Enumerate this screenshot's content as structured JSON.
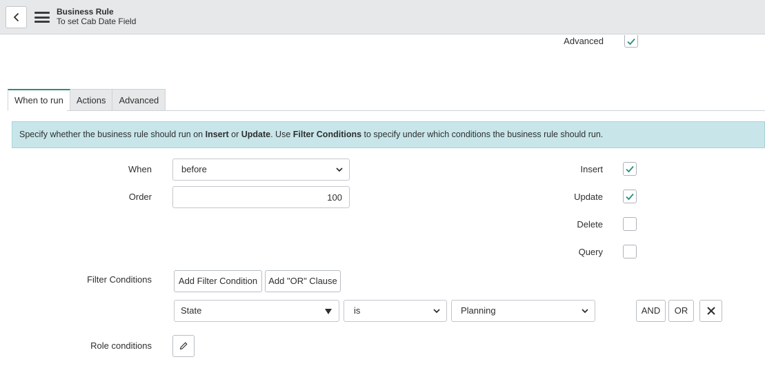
{
  "header": {
    "title": "Business Rule",
    "subtitle": "To set Cab Date Field"
  },
  "top_fields": {
    "advanced_label": "Advanced",
    "advanced_checked": true
  },
  "tabs": [
    {
      "label": "When to run",
      "active": true
    },
    {
      "label": "Actions",
      "active": false
    },
    {
      "label": "Advanced",
      "active": false
    }
  ],
  "info": {
    "part1": "Specify whether the business rule should run on ",
    "insert": "Insert",
    "or": " or ",
    "update": "Update",
    "part2": ". Use ",
    "filter": "Filter Conditions",
    "part3": " to specify under which conditions the business rule should run."
  },
  "form": {
    "when_label": "When",
    "when_value": "before",
    "order_label": "Order",
    "order_value": "100",
    "insert_label": "Insert",
    "insert_checked": true,
    "update_label": "Update",
    "update_checked": true,
    "delete_label": "Delete",
    "delete_checked": false,
    "query_label": "Query",
    "query_checked": false,
    "filter_label": "Filter Conditions",
    "add_filter_btn": "Add Filter Condition",
    "add_or_btn": "Add \"OR\" Clause",
    "condition": {
      "field": "State",
      "operator": "is",
      "value": "Planning"
    },
    "and_btn": "AND",
    "or_btn": "OR",
    "role_label": "Role conditions"
  },
  "colors": {
    "accent": "#278e7d",
    "info_bg": "#c8e6ea",
    "header_bg": "#e6e8ea"
  }
}
